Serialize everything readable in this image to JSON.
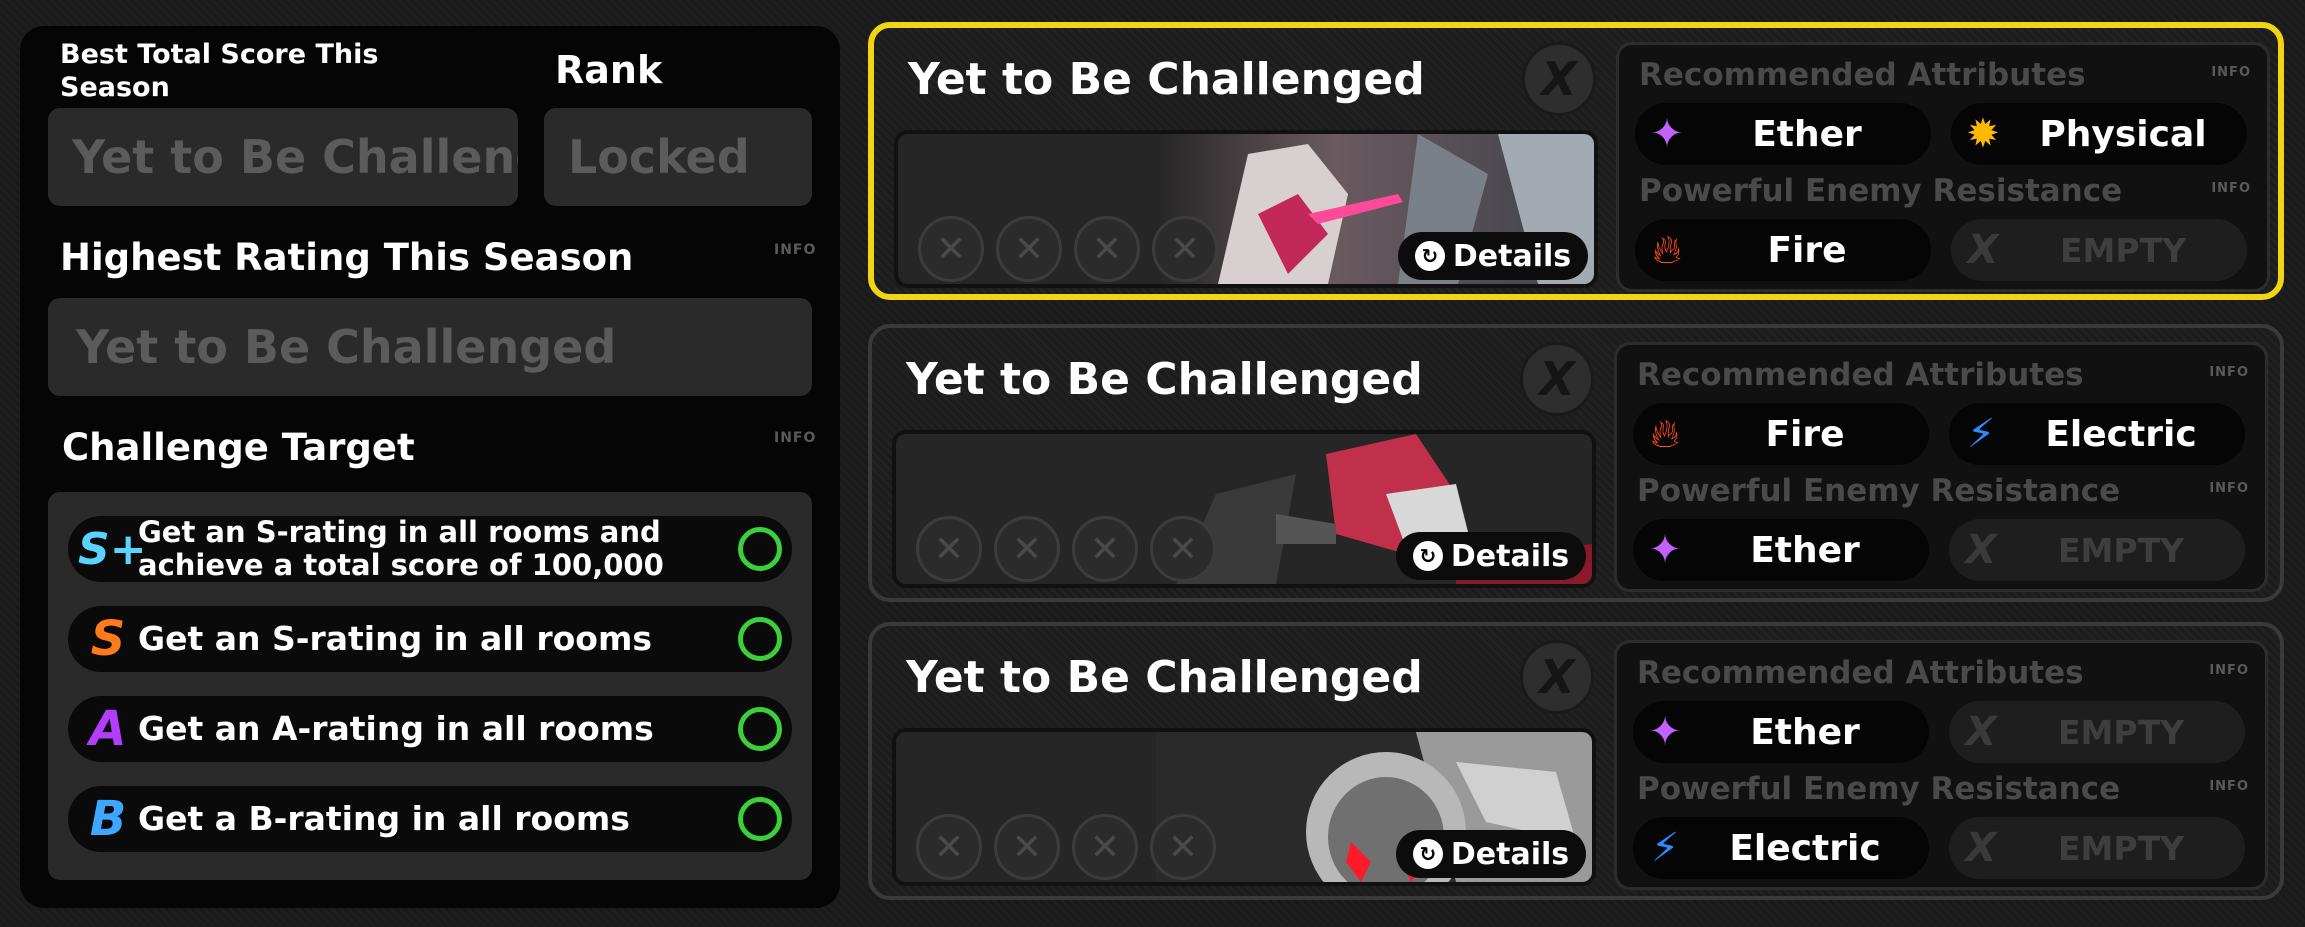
{
  "left": {
    "best_label": "Best Total Score This Season",
    "best_value": "Yet to Be Challenged",
    "rank_label": "Rank",
    "rank_value": "Locked",
    "highest_label": "Highest Rating This Season",
    "highest_info": "INFO",
    "highest_value": "Yet to Be Challenged",
    "target_label": "Challenge Target",
    "target_info": "INFO",
    "targets": [
      {
        "rank": "S+",
        "text": "Get an S-rating in all rooms and achieve a total score of 100,000"
      },
      {
        "rank": "S",
        "text": "Get an S-rating in all rooms"
      },
      {
        "rank": "A",
        "text": "Get an A-rating in all rooms"
      },
      {
        "rank": "B",
        "text": "Get a B-rating in all rooms"
      }
    ]
  },
  "cards": [
    {
      "title": "Yet to Be Challenged",
      "x_label": "X",
      "details_label": "Details",
      "rec_label": "Recommended Attributes",
      "res_label": "Powerful Enemy Resistance",
      "info": "INFO",
      "recommended": [
        {
          "label": "Ether",
          "icon": "ether-icon"
        },
        {
          "label": "Physical",
          "icon": "physical-icon"
        }
      ],
      "resistance": [
        {
          "label": "Fire",
          "icon": "fire-icon"
        },
        {
          "label": "EMPTY",
          "icon": "empty-x-icon"
        }
      ]
    },
    {
      "title": "Yet to Be Challenged",
      "x_label": "X",
      "details_label": "Details",
      "rec_label": "Recommended Attributes",
      "res_label": "Powerful Enemy Resistance",
      "info": "INFO",
      "recommended": [
        {
          "label": "Fire",
          "icon": "fire-icon"
        },
        {
          "label": "Electric",
          "icon": "electric-icon"
        }
      ],
      "resistance": [
        {
          "label": "Ether",
          "icon": "ether-icon"
        },
        {
          "label": "EMPTY",
          "icon": "empty-x-icon"
        }
      ]
    },
    {
      "title": "Yet to Be Challenged",
      "x_label": "X",
      "details_label": "Details",
      "rec_label": "Recommended Attributes",
      "res_label": "Powerful Enemy Resistance",
      "info": "INFO",
      "recommended": [
        {
          "label": "Ether",
          "icon": "ether-icon"
        },
        {
          "label": "EMPTY",
          "icon": "empty-x-icon"
        }
      ],
      "resistance": [
        {
          "label": "Electric",
          "icon": "electric-icon"
        },
        {
          "label": "EMPTY",
          "icon": "empty-x-icon"
        }
      ]
    }
  ],
  "colors": {
    "selected_border": "#f0d514",
    "check_ring": "#3ccf3c",
    "rank_s_plus": "#5ad4ff",
    "rank_s": "#ff7a1a",
    "rank_a": "#b23dff",
    "rank_b": "#3da6ff"
  }
}
